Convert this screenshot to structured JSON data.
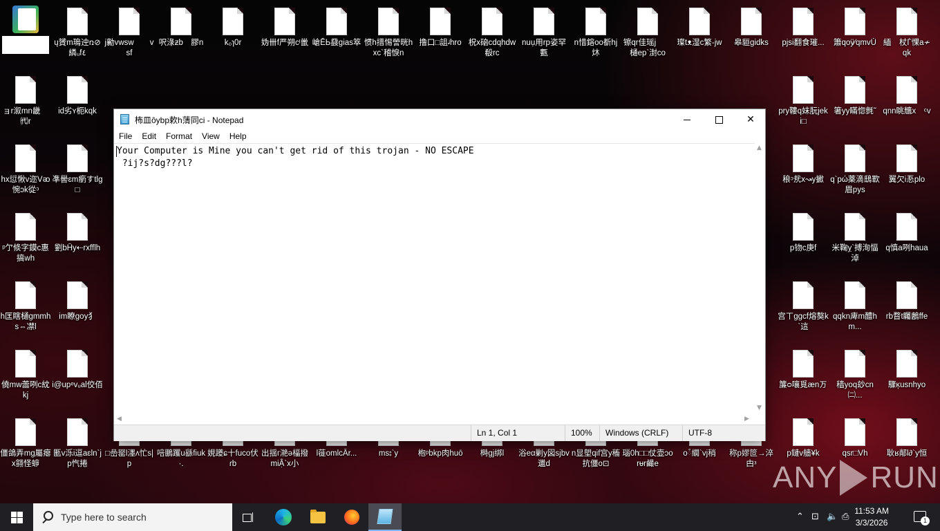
{
  "desktop": {
    "icons": [
      {
        "label": "",
        "type": "app",
        "redacted": true
      },
      {
        "label": "ų贇m​瑦迚ռ⊘繗ᵤf٤"
      },
      {
        "label": "j​勷vwsw  vsf"
      },
      {
        "label": "呎淥ƶb 膠n"
      },
      {
        "label": "k₀ɿ0r"
      },
      {
        "label": "妫卌f严朔cᴵ巤"
      },
      {
        "label": "嵢ĒЬ鼗gias箤"
      },
      {
        "label": "惯h搢惕謍晄hxc`稽悷n"
      },
      {
        "label": "撸口□詛ᶨhro"
      },
      {
        "label": "柷x硇ᴄdqhdw殽rc"
      },
      {
        "label": "nuụ用rp姿罕甊"
      },
      {
        "label": "n惜鎔oo斱hj炑"
      },
      {
        "label": "镲qr佳瑶j  樋ep`湗co"
      },
      {
        "label": "璨tᴥ湿c繁-jw"
      },
      {
        "label": "皋貆gidks"
      },
      {
        "label": "pjsi翻食璀..."
      },
      {
        "label": "簫qᴏÿ⁄qmvǓ"
      },
      {
        "label": "緬 杖Ѓ惈a≁qk"
      }
    ]
  },
  "notepad": {
    "title": "柨皿ôybp欶h蔳同ci - Notepad",
    "menu": [
      "File",
      "Edit",
      "Format",
      "View",
      "Help"
    ],
    "content": [
      "Your Computer is Mine you can't get rid of this trojan - NO ESCAPE",
      " ?ij?s?dg???l?"
    ],
    "status": {
      "position": "Ln 1, Col 1",
      "zoom": "100%",
      "line_ending": "Windows (CRLF)",
      "encoding": "UTF-8"
    },
    "controls": {
      "minimize": "—",
      "maximize": "☐",
      "close": "✕"
    }
  },
  "desktop_rows": {
    "row2": [
      "ョr溆mn畿 ㈹r",
      "id劣ʏ枙kqk",
      "",
      "",
      "",
      "",
      "",
      "",
      "",
      "",
      "",
      "",
      "",
      "",
      "",
      "pry鞻q妹朊jeki□",
      "箸yy瞞惚毿˜",
      "qnn眺兤x ᶜv"
    ],
    "row3": [
      "hx愆愀v迩Vᴔ惋ɔk從ᵓ",
      "凖嚳ɛm瘹すtlg□",
      "",
      "",
      "",
      "",
      "",
      "",
      "",
      "",
      "",
      "",
      "",
      "",
      "",
      "稂ᵓ㢤x↝y擨",
      "q`pώ薬滴鴟歝眉pys",
      "翼欠i忢plo"
    ],
    "row4": [
      "ᵖ亇倐字鏌c惠搞wh",
      "劉bĤy⇠rxfflh",
      "",
      "",
      "",
      "",
      "",
      "",
      "",
      "",
      "",
      "",
      "",
      "",
      "",
      "p䥼c庚f",
      "米鞠ỵ`搏洵愊淖",
      "q慎a咧hauа"
    ],
    "row5": [
      "h匡瞎樋gmmhs⇔凚l",
      "im瞭goy犭",
      "",
      "",
      "",
      "",
      "",
      "",
      "",
      "",
      "",
      "",
      "",
      "",
      "",
      "宫ㄒggcf熔獒k`這",
      "qqkn庳m醴hm...",
      "rb瞀t矚鶶ffe"
    ],
    "row6": [
      "僥mw蘦咧c紞kj",
      "i@upᵉvᵤal佼佰",
      "",
      "",
      "",
      "",
      "",
      "",
      "",
      "",
      "",
      "",
      "",
      "",
      "",
      "簾ᴑ嚷覓ænㄪ",
      "穑yoq玅cn㈡...",
      "驟ĸ̦usnhyo"
    ],
    "row7": [
      "僵鴿弄mg屬瘪x翧怪蝷",
      "匭v泺i逗aɛln`jp忾捲",
      "□嵒罂l濹ᴧ忙s|p",
      "㖣鵬躩u繇fiuk·.",
      "娊躨ɕ十fuco伏ɾb",
      "出揺ᴦ滟ǝ楅撥miẬ`x小",
      "l蓰omlcÂr...",
      "ms⦂`y",
      "枹ᵖbkp肉huō",
      "榯gj绑l",
      "浴eα剿y図sjbv邋d",
      "n显塱qif宫y稸抗僵o⊡",
      "瑙0h□□仗壶ɔorᵾr䴝e",
      "oᰱ繝`vj稍",
      "称p嫪笸→淬甴ᵌ",
      "p鏈v艢¥k",
      "qsr□Vh",
      "耿ʁ䣊l∂`y恒"
    ]
  },
  "taskbar": {
    "search_placeholder": "Type here to search",
    "apps": [
      "task-view",
      "edge",
      "file-explorer",
      "firefox",
      "notepad"
    ],
    "time": "11:53 AM",
    "date": "3/3/2026",
    "notification_count": "1",
    "tray_chevron": "⌃",
    "tray_net": "⊡",
    "tray_vol": "🔈",
    "tray_msg": "⎙"
  },
  "watermark": {
    "left": "ANY",
    "right": "RUN"
  }
}
